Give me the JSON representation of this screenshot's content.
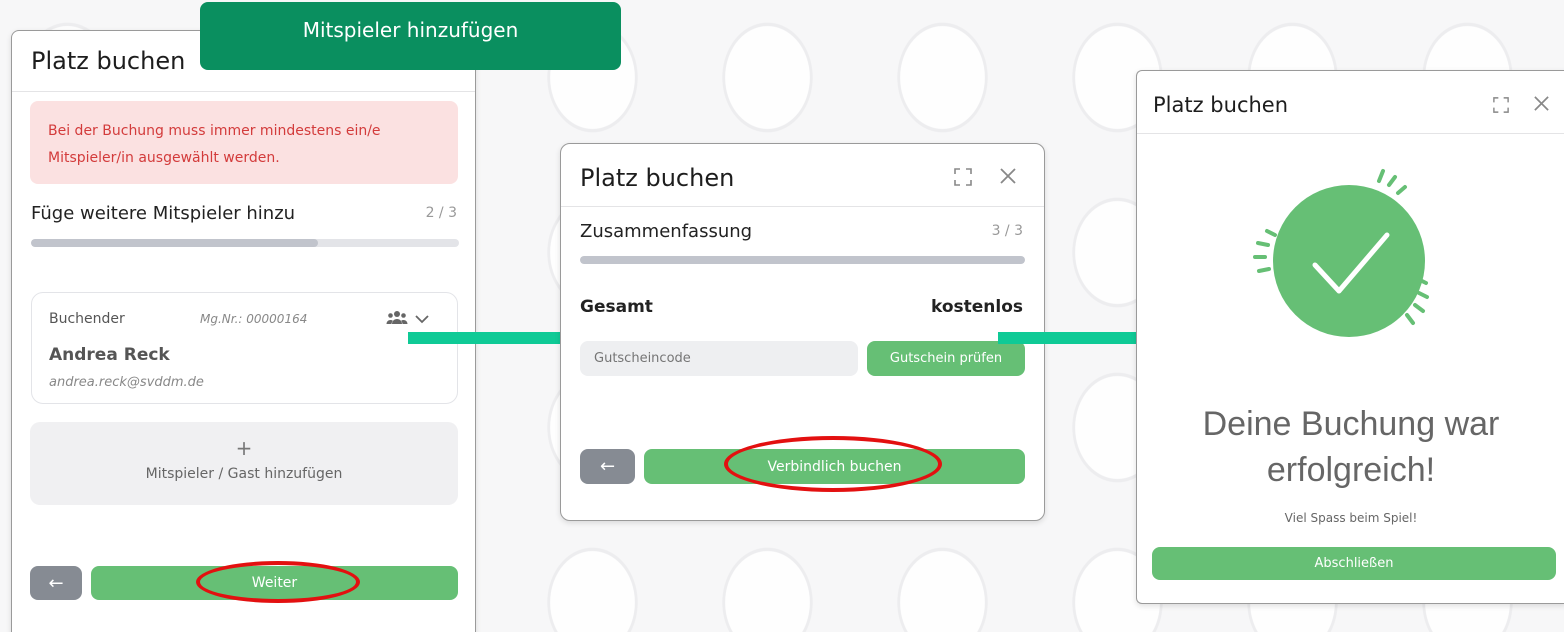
{
  "banner": {
    "label": "Mitspieler hinzufügen"
  },
  "step2": {
    "title": "Platz buchen",
    "alert": "Bei der Buchung muss immer mindestens ein/e Mitspieler/in ausgewählt werden.",
    "step_label": "Füge weitere Mitspieler hinzu",
    "step_count": "2 / 3",
    "progress": 0.67,
    "booker": {
      "role": "Buchender",
      "member_no": "Mg.Nr.: 00000164",
      "name": "Andrea Reck",
      "email": "andrea.reck@svddm.de",
      "icon": "users-icon"
    },
    "add_player": {
      "plus": "+",
      "label": "Mitspieler / Gast hinzufügen"
    },
    "back_label": "←",
    "next_label": "Weiter"
  },
  "step3": {
    "title": "Platz buchen",
    "step_label": "Zusammenfassung",
    "step_count": "3 / 3",
    "progress": 1.0,
    "total_label": "Gesamt",
    "total_value": "kostenlos",
    "voucher_placeholder": "Gutscheincode",
    "voucher_button": "Gutschein prüfen",
    "back_label": "←",
    "book_label": "Verbindlich buchen"
  },
  "success": {
    "title": "Platz buchen",
    "headline_line1": "Deine Buchung war",
    "headline_line2": "erfolgreich!",
    "subtext": "Viel Spass beim Spiel!",
    "finish_label": "Abschließen"
  },
  "colors": {
    "accent_green": "#66bf75",
    "banner_green": "#0a8f5f",
    "arrow_teal": "#0fca96",
    "alert_bg": "#fbe1e1",
    "alert_text": "#d33b3b",
    "highlight_red": "#e31010"
  }
}
